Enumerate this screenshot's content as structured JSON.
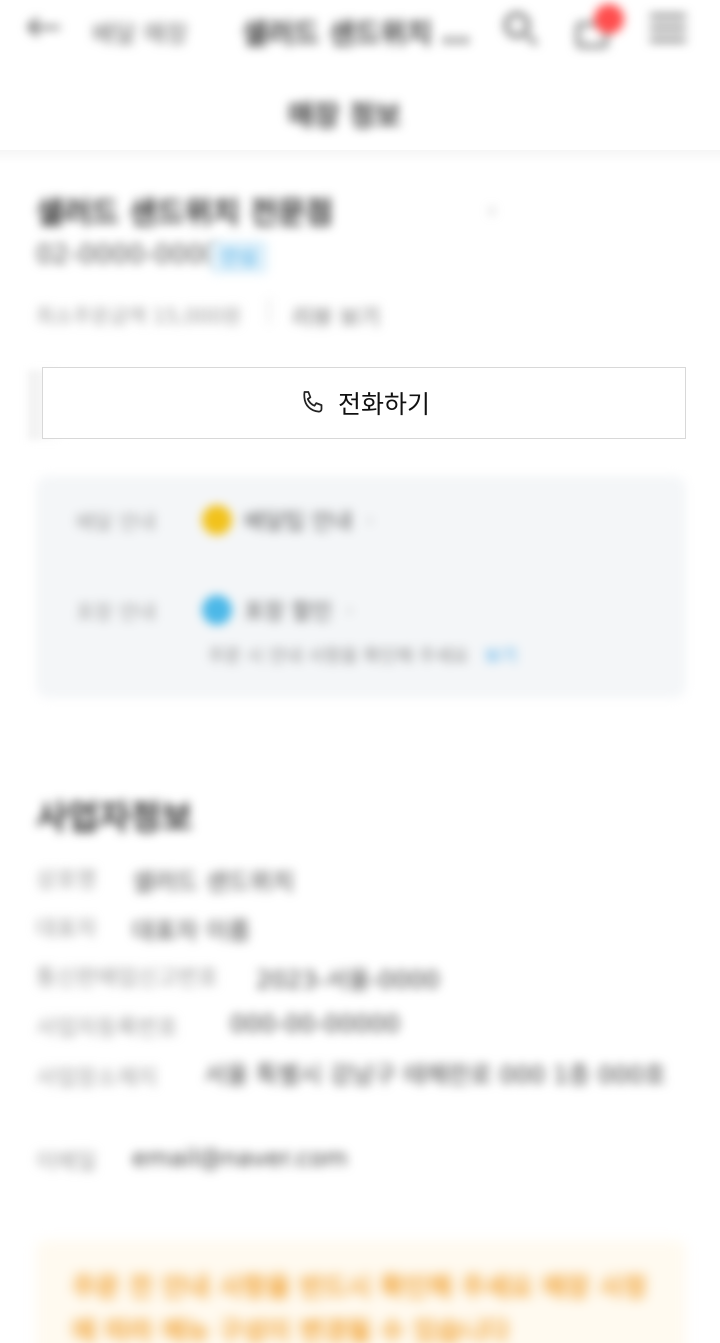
{
  "header": {
    "crumb": "배달 매장",
    "store_title": "샐러드 샌드위치 전문점",
    "subtab": "매장 정보"
  },
  "store": {
    "name": "샐러드 샌드위치 전문점",
    "phone": "02-0000-0000",
    "phone_badge": "안심",
    "meta": "최소주문금액 15,000원",
    "meta_2": "리뷰 보기"
  },
  "call_button": {
    "label": "전화하기"
  },
  "delivery": {
    "rows": [
      {
        "key": "배달 안내",
        "value": "배달팁 안내",
        "dot_color": "#f2c21b"
      },
      {
        "key": "포장 안내",
        "value": "포장 할인",
        "dot_color": "#4cb8e8"
      }
    ],
    "note": "주문 시 안내 사항을 확인해 주세요",
    "note_link": "보기"
  },
  "business": {
    "title": "사업자정보",
    "rows": [
      {
        "key": "상호명",
        "value": "샐러드 샌드위치"
      },
      {
        "key": "대표자",
        "value": "대표자 이름"
      },
      {
        "key": "통신판매업신고번호",
        "value": "2023-서울-0000"
      },
      {
        "key": "사업자등록번호",
        "value": "000-00-00000"
      },
      {
        "key": "사업장소재지",
        "value": ""
      },
      {
        "key": "이메일",
        "value": "email@naver.com"
      }
    ],
    "address": "서울 특별시 강남구 테헤란로 000 1층 000호"
  },
  "notice": {
    "text": "주문 전 안내 사항을 반드시 확인해 주세요 매장 사정에 따라 메뉴 구성이 변경될 수 있습니다"
  }
}
